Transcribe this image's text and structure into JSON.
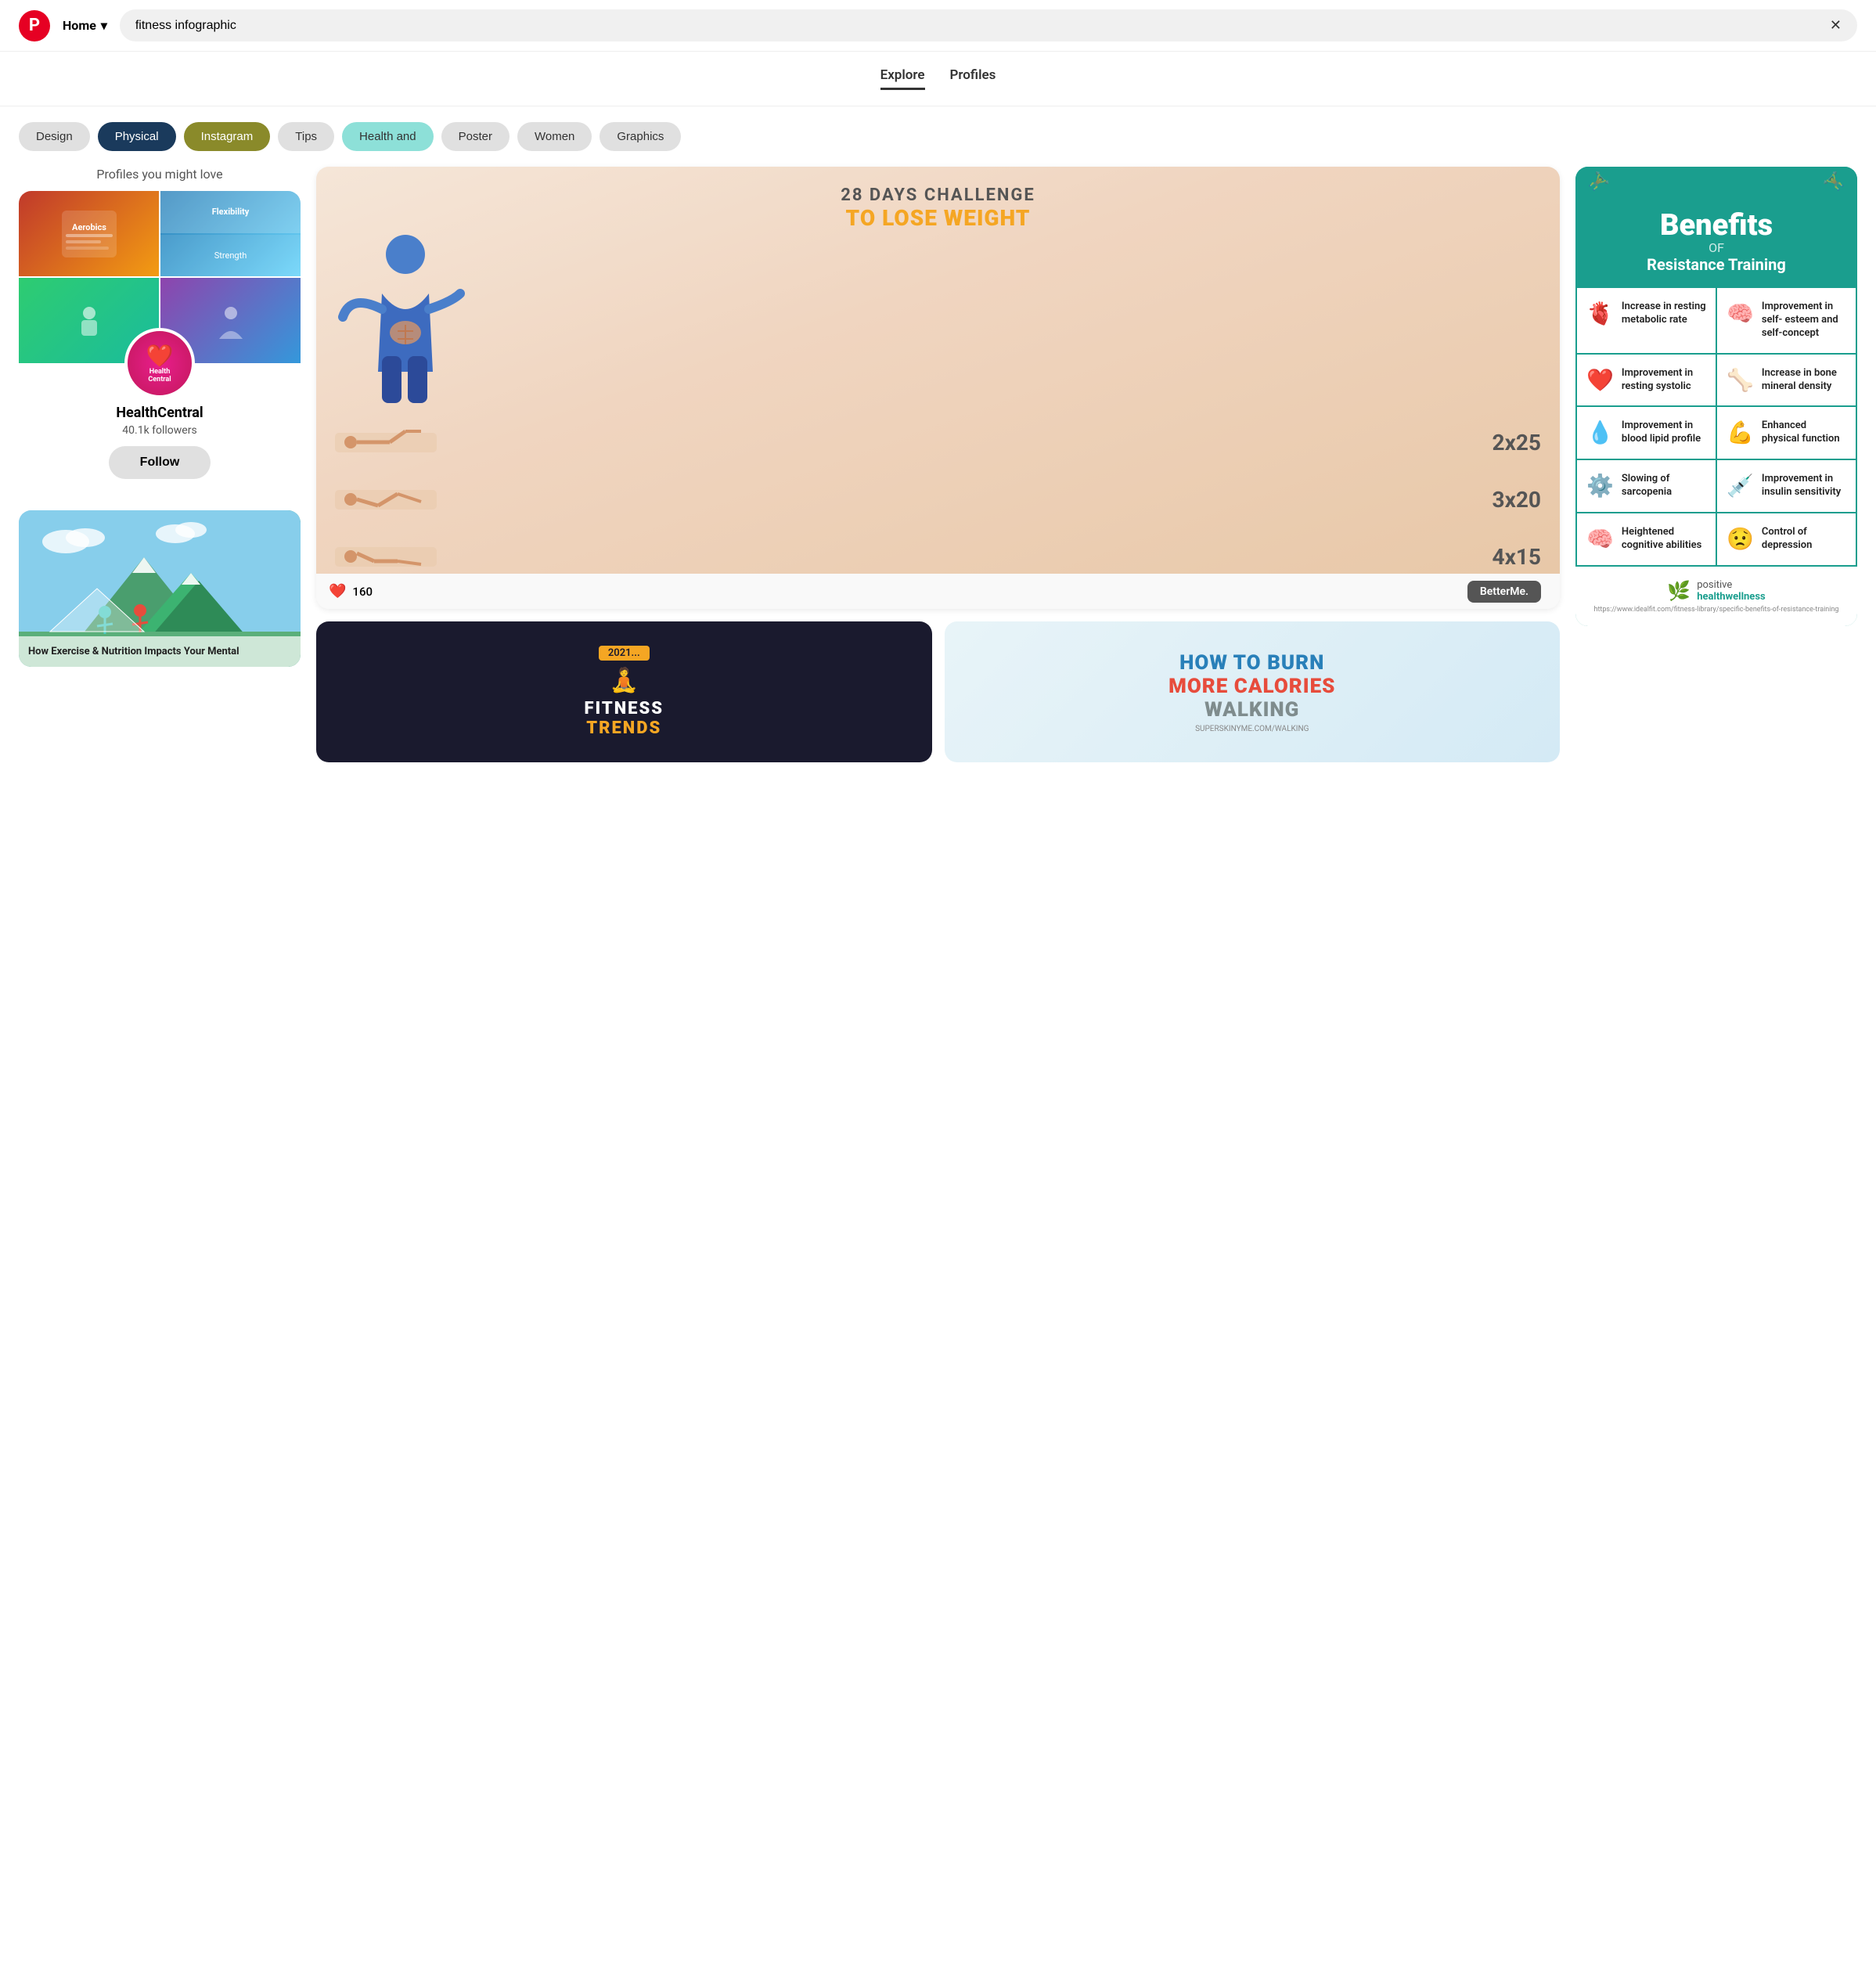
{
  "header": {
    "logo_label": "P",
    "home_label": "Home",
    "home_chevron": "▾",
    "search_value": "fitness infographic",
    "search_clear_label": "✕"
  },
  "tabs": {
    "explore_label": "Explore",
    "profiles_label": "Profiles",
    "active": "explore"
  },
  "filters": [
    {
      "id": "design",
      "label": "Design",
      "style": "chip-default"
    },
    {
      "id": "physical",
      "label": "Physical",
      "style": "chip-dark-navy"
    },
    {
      "id": "instagram",
      "label": "Instagram",
      "style": "chip-olive"
    },
    {
      "id": "tips",
      "label": "Tips",
      "style": "chip-default"
    },
    {
      "id": "health",
      "label": "Health and",
      "style": "chip-teal"
    },
    {
      "id": "poster",
      "label": "Poster",
      "style": "chip-default"
    },
    {
      "id": "women",
      "label": "Women",
      "style": "chip-default"
    },
    {
      "id": "graphics",
      "label": "Graphics",
      "style": "chip-default"
    }
  ],
  "profiles_section": {
    "title": "Profiles you might love",
    "profile": {
      "name": "HealthCentral",
      "followers": "40.1k followers",
      "avatar_line1": "Health",
      "avatar_line2": "Central",
      "follow_label": "Follow"
    }
  },
  "bottom_left_card": {
    "text": "How Exercise & Nutrition Impacts Your Mental"
  },
  "weight_loss_pin": {
    "title_top": "28 DAYS CHALLENGE",
    "title_main": "TO LOSE WEIGHT",
    "exercises": [
      {
        "reps": "2x25"
      },
      {
        "reps": "3x20"
      },
      {
        "reps": "4x15"
      }
    ],
    "brand": "BetterMe.",
    "likes": "160"
  },
  "fitness_trends": {
    "year": "2021...",
    "figure_emoji": "🧘",
    "title": "FITNESS",
    "subtitle": "TRENDS"
  },
  "calories_card": {
    "line1": "HOW TO BURN",
    "line2": "MORE CALORIES",
    "line3": "WALKING",
    "sub": "SUPERSKINYME.COM/WALKING"
  },
  "benefits_card": {
    "title": "Benefits",
    "of_label": "OF",
    "subtitle": "Resistance Training",
    "benefits": [
      {
        "icon": "🫀",
        "text": "Increase in resting metabolic rate"
      },
      {
        "icon": "🧠",
        "text": "Improvement in self- esteem and self-concept"
      },
      {
        "icon": "❤️",
        "text": "Improvement in resting systolic"
      },
      {
        "icon": "🦴",
        "text": "Increase in bone mineral density"
      },
      {
        "icon": "💧",
        "text": "Improvement in blood lipid profile"
      },
      {
        "icon": "💪",
        "text": "Enhanced physical function"
      },
      {
        "icon": "⚙️",
        "text": "Slowing of sarcopenia"
      },
      {
        "icon": "💉",
        "text": "Improvement in insulin sensitivity"
      },
      {
        "icon": "🧠",
        "text": "Heightened cognitive abilities"
      },
      {
        "icon": "😟",
        "text": "Control of depression"
      }
    ],
    "footer": {
      "icon": "🌿",
      "line1": "positive",
      "line2": "healthwellness",
      "url": "https://www.idealfit.com/fitness-library/specific-benefits-of-resistance-training"
    }
  }
}
